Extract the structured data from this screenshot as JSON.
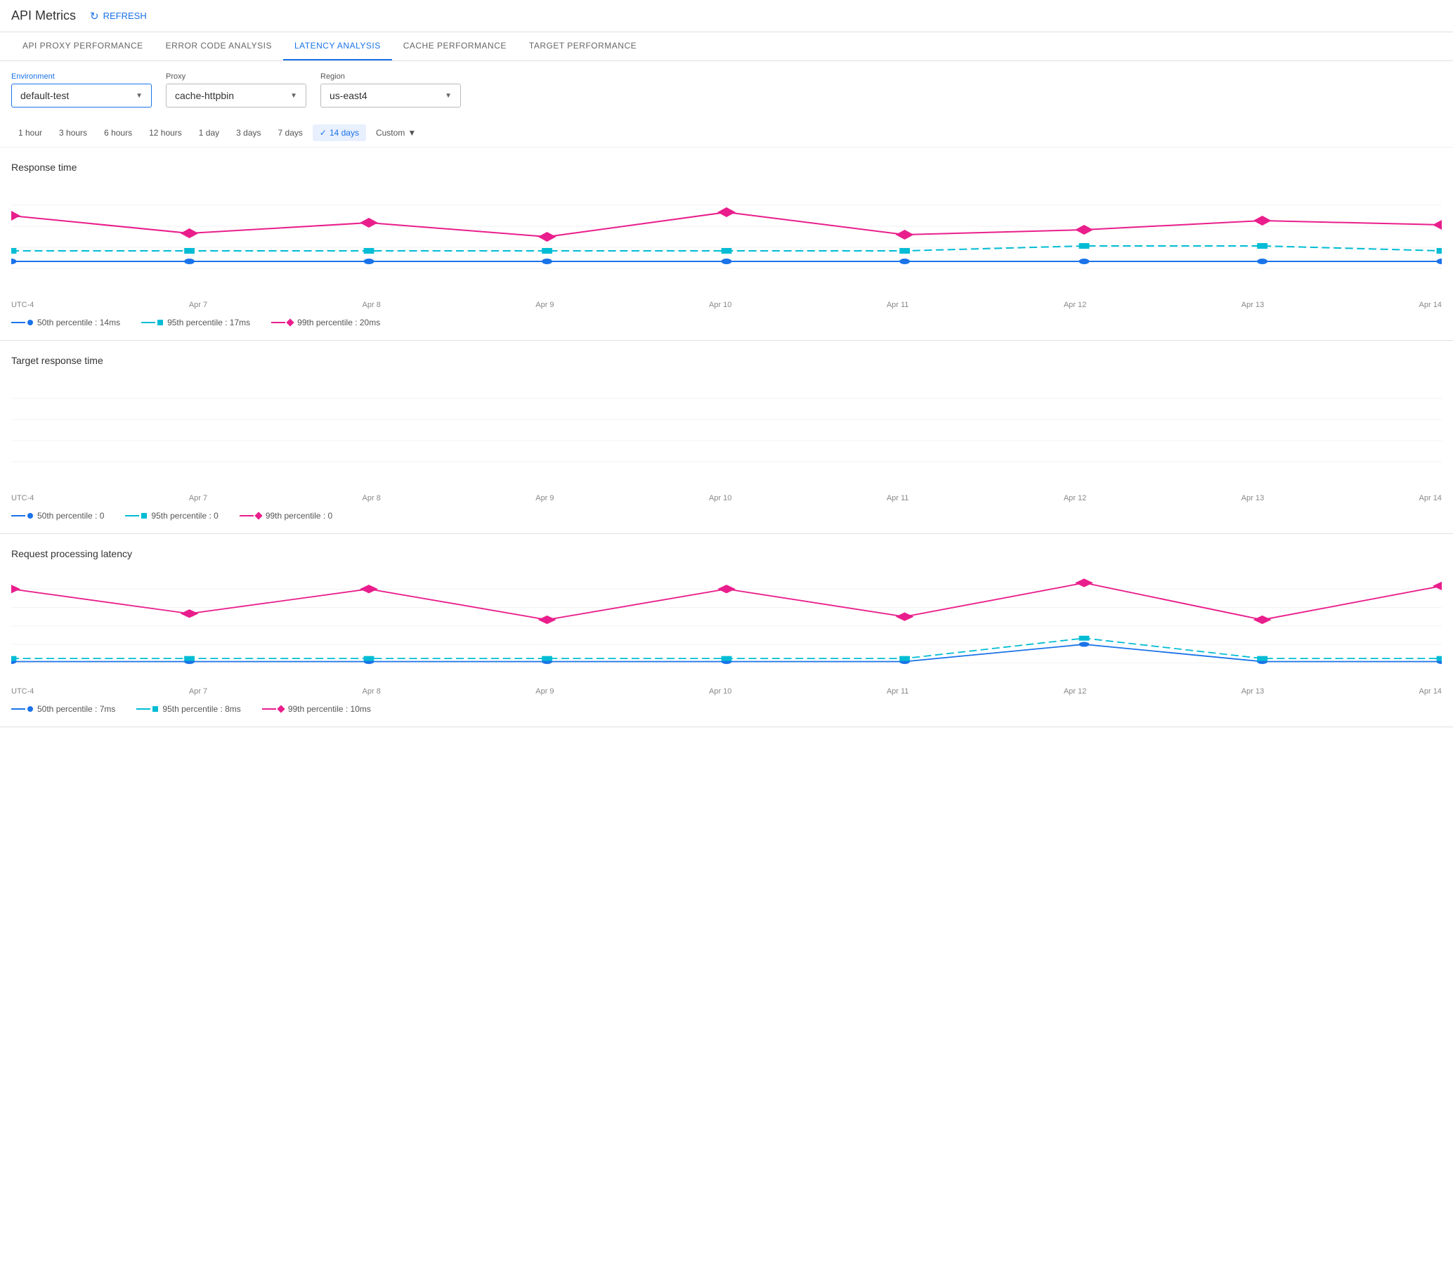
{
  "header": {
    "title": "API Metrics",
    "refresh_label": "REFRESH"
  },
  "tabs": [
    {
      "label": "API PROXY PERFORMANCE",
      "active": false
    },
    {
      "label": "ERROR CODE ANALYSIS",
      "active": false
    },
    {
      "label": "LATENCY ANALYSIS",
      "active": true
    },
    {
      "label": "CACHE PERFORMANCE",
      "active": false
    },
    {
      "label": "TARGET PERFORMANCE",
      "active": false
    }
  ],
  "filters": {
    "environment": {
      "label": "Environment",
      "value": "default-test"
    },
    "proxy": {
      "label": "Proxy",
      "value": "cache-httpbin"
    },
    "region": {
      "label": "Region",
      "value": "us-east4"
    }
  },
  "time_range": {
    "options": [
      "1 hour",
      "3 hours",
      "6 hours",
      "12 hours",
      "1 day",
      "3 days",
      "7 days",
      "14 days",
      "Custom"
    ],
    "active": "14 days",
    "custom_label": "Custom"
  },
  "charts": [
    {
      "id": "response-time",
      "title": "Response time",
      "x_labels": [
        "UTC-4",
        "Apr 7",
        "Apr 8",
        "Apr 9",
        "Apr 10",
        "Apr 11",
        "Apr 12",
        "Apr 13",
        "Apr 14"
      ],
      "legend": [
        {
          "type": "dot-line",
          "color": "blue",
          "label": "50th percentile : 14ms"
        },
        {
          "type": "dash-line",
          "color": "teal",
          "label": "95th percentile : 17ms"
        },
        {
          "type": "diamond-line",
          "color": "pink",
          "label": "99th percentile : 20ms"
        }
      ]
    },
    {
      "id": "target-response-time",
      "title": "Target response time",
      "x_labels": [
        "UTC-4",
        "Apr 7",
        "Apr 8",
        "Apr 9",
        "Apr 10",
        "Apr 11",
        "Apr 12",
        "Apr 13",
        "Apr 14"
      ],
      "legend": [
        {
          "type": "dot-line",
          "color": "blue",
          "label": "50th percentile : 0"
        },
        {
          "type": "dash-line",
          "color": "teal",
          "label": "95th percentile : 0"
        },
        {
          "type": "diamond-line",
          "color": "pink",
          "label": "99th percentile : 0"
        }
      ]
    },
    {
      "id": "request-processing-latency",
      "title": "Request processing latency",
      "x_labels": [
        "UTC-4",
        "Apr 7",
        "Apr 8",
        "Apr 9",
        "Apr 10",
        "Apr 11",
        "Apr 12",
        "Apr 13",
        "Apr 14"
      ],
      "legend": [
        {
          "type": "dot-line",
          "color": "blue",
          "label": "50th percentile : 7ms"
        },
        {
          "type": "dash-line",
          "color": "teal",
          "label": "95th percentile : 8ms"
        },
        {
          "type": "diamond-line",
          "color": "pink",
          "label": "99th percentile : 10ms"
        }
      ]
    }
  ]
}
